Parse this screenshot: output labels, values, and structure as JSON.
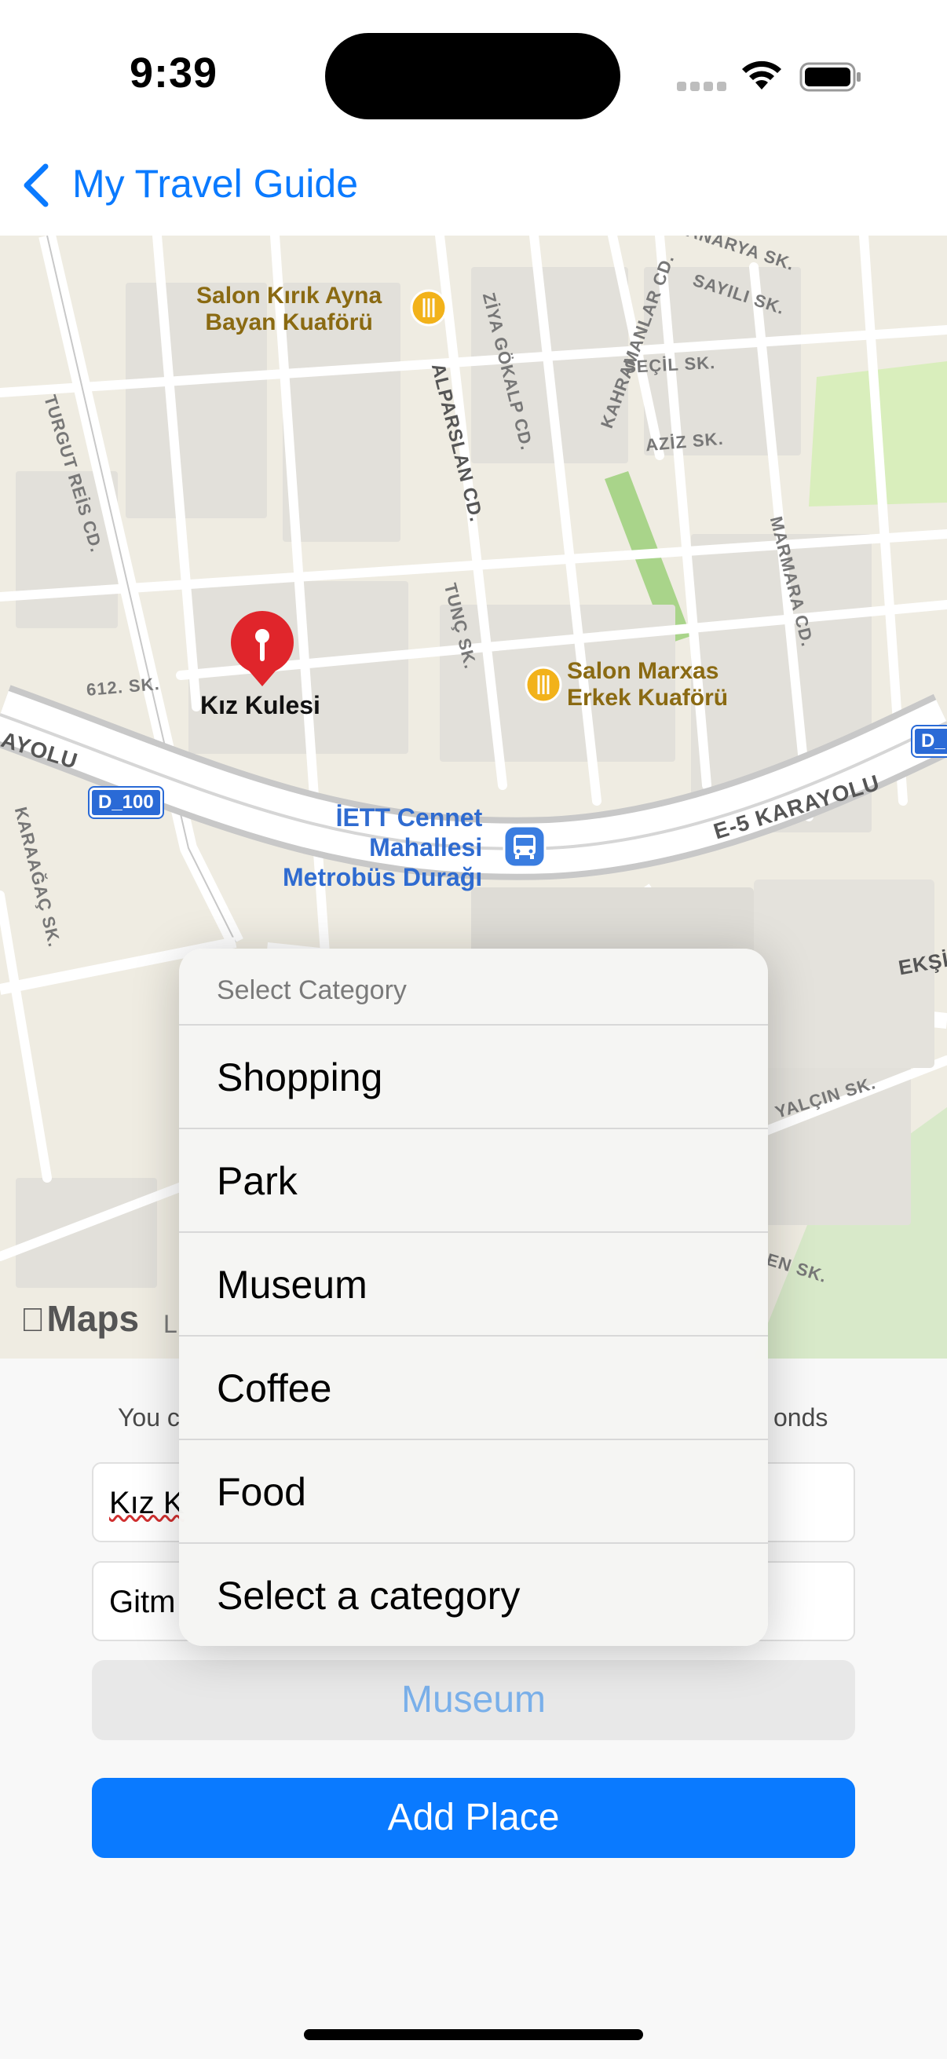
{
  "status_bar": {
    "time": "9:39"
  },
  "nav": {
    "back_label": "My Travel Guide"
  },
  "map": {
    "pois": [
      {
        "label": "Salon Kırık Ayna\nBayan Kuaförü"
      },
      {
        "label": "Salon Marxas\nErkek Kuaförü"
      }
    ],
    "pin_label": "Kız Kulesi",
    "transit_label": "İETT Cennet\nMahallesi\nMetrobüs Durağı",
    "streets": [
      "TURGUT REİS CD.",
      "ALPARSLAN CD.",
      "ZİYA GÖKALP CD.",
      "KAHRAMANLAR CD.",
      "TUNÇ SK.",
      "612. SK.",
      "MARMARA CD.",
      "E-5 KARAYOLU",
      "AYOLU",
      "KARAAĞAÇ SK.",
      "SEÇİL SK.",
      "AZİZ SK.",
      "SAYILI SK.",
      "KANARYA SK.",
      "YALÇIN SK.",
      "EKŞİ",
      "EN SK."
    ],
    "road_badges": [
      "D_100",
      "D_"
    ],
    "attribution": "Maps",
    "legal": "L"
  },
  "form": {
    "info_left": "You c",
    "info_right": "onds",
    "name_field": "Kız K",
    "note_field": "Gitm",
    "category_button": "Museum",
    "add_button": "Add Place"
  },
  "menu": {
    "header": "Select Category",
    "items": [
      "Shopping",
      "Park",
      "Museum",
      "Coffee",
      "Food",
      "Select a category"
    ]
  },
  "colors": {
    "accent": "#0a7aff",
    "pin": "#e0252b",
    "poi": "#8a6a12",
    "transit": "#2f6bd0"
  }
}
